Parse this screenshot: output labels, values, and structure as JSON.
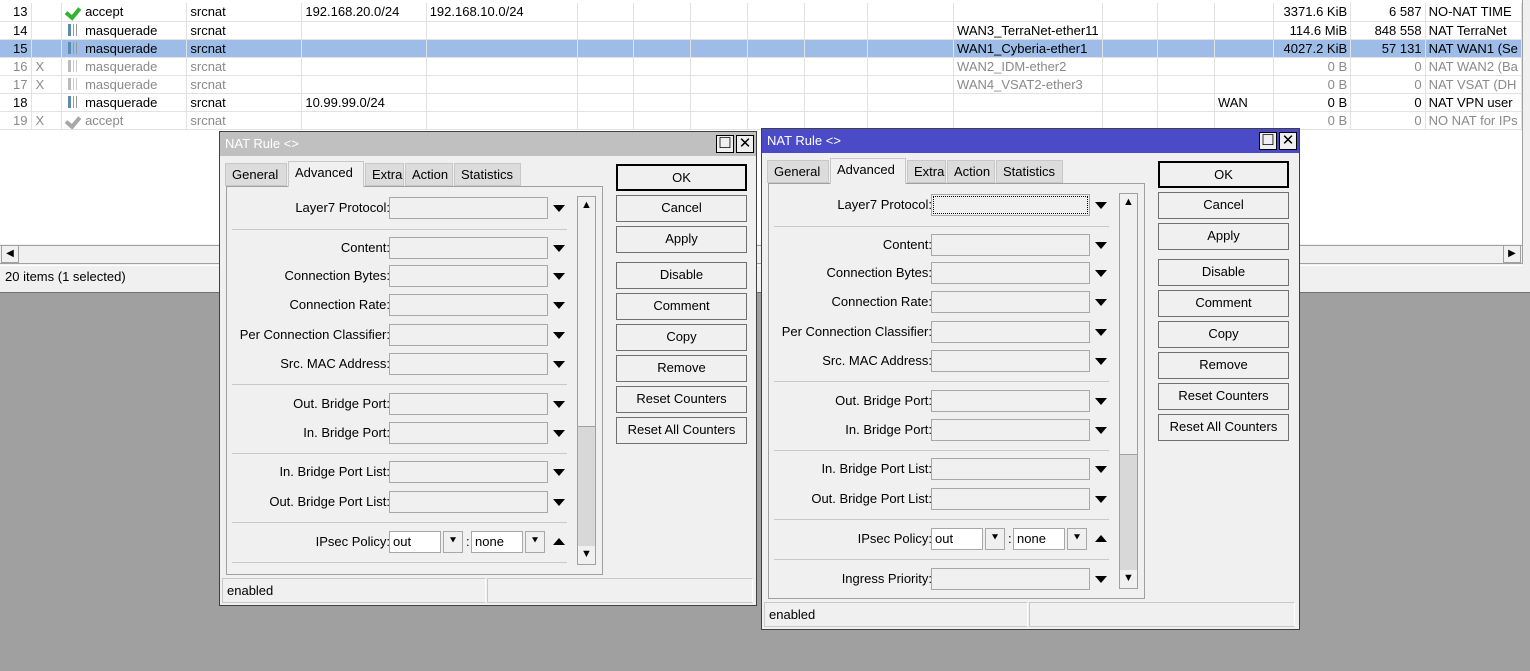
{
  "list": {
    "rows": [
      {
        "num": "13",
        "flag": "",
        "action": "accept",
        "icon": "accept",
        "chain": "srcnat",
        "src": "192.168.20.0/24",
        "dst": "192.168.10.0/24",
        "out": "",
        "inlist": "",
        "bytes": "3371.6 KiB",
        "packets": "6 587",
        "comment": "NO-NAT TIME",
        "disabled": false,
        "selected": false
      },
      {
        "num": "14",
        "flag": "",
        "action": "masquerade",
        "icon": "masq",
        "chain": "srcnat",
        "src": "",
        "dst": "",
        "out": "WAN3_TerraNet-ether11",
        "inlist": "",
        "bytes": "114.6 MiB",
        "packets": "848 558",
        "comment": "NAT TerraNet",
        "disabled": false,
        "selected": false
      },
      {
        "num": "15",
        "flag": "",
        "action": "masquerade",
        "icon": "masq",
        "chain": "srcnat",
        "src": "",
        "dst": "",
        "out": "WAN1_Cyberia-ether1",
        "inlist": "",
        "bytes": "4027.2 KiB",
        "packets": "57 131",
        "comment": "NAT WAN1 (Se",
        "disabled": false,
        "selected": true
      },
      {
        "num": "16",
        "flag": "X",
        "action": "masquerade",
        "icon": "masq",
        "chain": "srcnat",
        "src": "",
        "dst": "",
        "out": "WAN2_IDM-ether2",
        "inlist": "",
        "bytes": "0 B",
        "packets": "0",
        "comment": "NAT WAN2 (Ba",
        "disabled": true,
        "selected": false
      },
      {
        "num": "17",
        "flag": "X",
        "action": "masquerade",
        "icon": "masq",
        "chain": "srcnat",
        "src": "",
        "dst": "",
        "out": "WAN4_VSAT2-ether3",
        "inlist": "",
        "bytes": "0 B",
        "packets": "0",
        "comment": "NAT VSAT (DH",
        "disabled": true,
        "selected": false
      },
      {
        "num": "18",
        "flag": "",
        "action": "masquerade",
        "icon": "masq",
        "chain": "srcnat",
        "src": "10.99.99.0/24",
        "dst": "",
        "out": "",
        "inlist": "WAN",
        "bytes": "0 B",
        "packets": "0",
        "comment": "NAT VPN user",
        "disabled": false,
        "selected": false
      },
      {
        "num": "19",
        "flag": "X",
        "action": "accept",
        "icon": "accept",
        "chain": "srcnat",
        "src": "",
        "dst": "",
        "out": "",
        "inlist": "",
        "bytes": "0 B",
        "packets": "0",
        "comment": "NO NAT for IPs",
        "disabled": true,
        "selected": false
      }
    ],
    "status": "20 items (1 selected)"
  },
  "dialogs": [
    {
      "title": "NAT Rule <>",
      "active": false,
      "tabs": [
        "General",
        "Advanced",
        "Extra",
        "Action",
        "Statistics"
      ],
      "active_tab": "Advanced",
      "buttons": [
        "OK",
        "Cancel",
        "Apply",
        "Disable",
        "Comment",
        "Copy",
        "Remove",
        "Reset Counters",
        "Reset All Counters"
      ],
      "fields": [
        {
          "label": "Layer7 Protocol:",
          "value": ""
        },
        {
          "sep": true
        },
        {
          "label": "Content:",
          "value": ""
        },
        {
          "label": "Connection Bytes:",
          "value": ""
        },
        {
          "label": "Connection Rate:",
          "value": ""
        },
        {
          "label": "Per Connection Classifier:",
          "value": ""
        },
        {
          "label": "Src. MAC Address:",
          "value": ""
        },
        {
          "sep": true
        },
        {
          "label": "Out. Bridge Port:",
          "value": ""
        },
        {
          "label": "In. Bridge Port:",
          "value": ""
        },
        {
          "sep": true
        },
        {
          "label": "In. Bridge Port List:",
          "value": ""
        },
        {
          "label": "Out. Bridge Port List:",
          "value": ""
        },
        {
          "sep": true
        },
        {
          "label": "IPsec Policy:",
          "ipsec": [
            "out",
            "none"
          ]
        },
        {
          "sep": true
        }
      ],
      "status": "enabled"
    },
    {
      "title": "NAT Rule <>",
      "active": true,
      "tabs": [
        "General",
        "Advanced",
        "Extra",
        "Action",
        "Statistics"
      ],
      "active_tab": "Advanced",
      "buttons": [
        "OK",
        "Cancel",
        "Apply",
        "Disable",
        "Comment",
        "Copy",
        "Remove",
        "Reset Counters",
        "Reset All Counters"
      ],
      "fields": [
        {
          "label": "Layer7 Protocol:",
          "value": "",
          "focus": true
        },
        {
          "sep": true
        },
        {
          "label": "Content:",
          "value": ""
        },
        {
          "label": "Connection Bytes:",
          "value": ""
        },
        {
          "label": "Connection Rate:",
          "value": ""
        },
        {
          "label": "Per Connection Classifier:",
          "value": ""
        },
        {
          "label": "Src. MAC Address:",
          "value": ""
        },
        {
          "sep": true
        },
        {
          "label": "Out. Bridge Port:",
          "value": ""
        },
        {
          "label": "In. Bridge Port:",
          "value": ""
        },
        {
          "sep": true
        },
        {
          "label": "In. Bridge Port List:",
          "value": ""
        },
        {
          "label": "Out. Bridge Port List:",
          "value": ""
        },
        {
          "sep": true
        },
        {
          "label": "IPsec Policy:",
          "ipsec": [
            "out",
            "none"
          ]
        },
        {
          "sep": true
        },
        {
          "label": "Ingress Priority:",
          "value": ""
        }
      ],
      "status": "enabled"
    }
  ]
}
